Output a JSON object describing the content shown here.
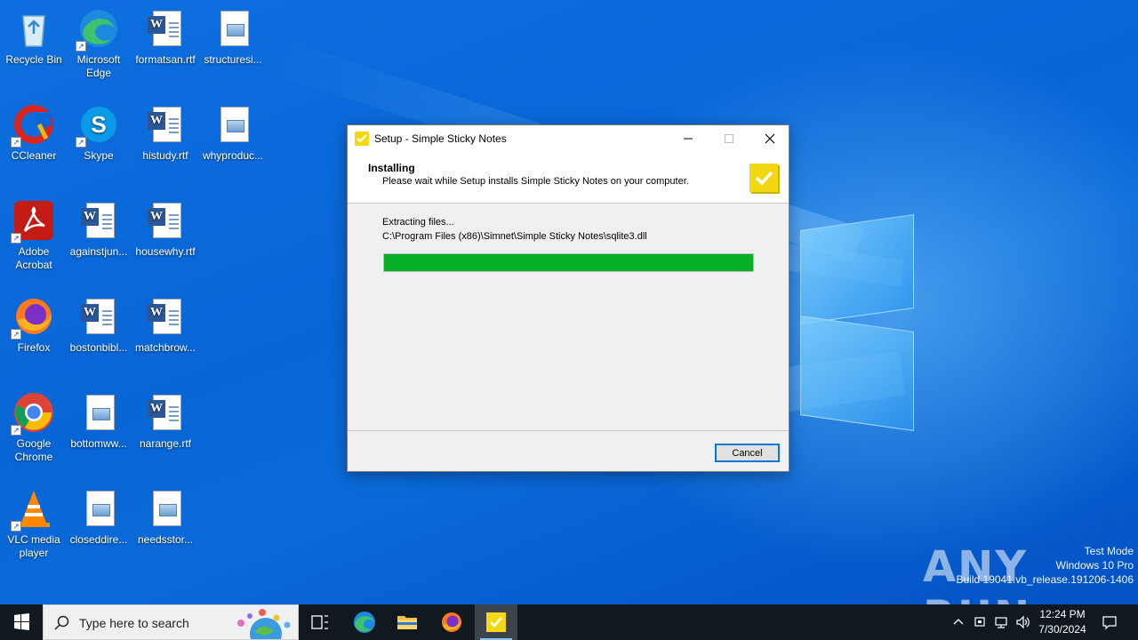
{
  "desktop": {
    "icons": [
      {
        "label": "Recycle Bin"
      },
      {
        "label": "Microsoft Edge"
      },
      {
        "label": "formatsan.rtf"
      },
      {
        "label": "structuresi..."
      },
      {
        "label": "CCleaner"
      },
      {
        "label": "Skype"
      },
      {
        "label": "histudy.rtf"
      },
      {
        "label": "whyproduc..."
      },
      {
        "label": "Adobe Acrobat"
      },
      {
        "label": "againstjun..."
      },
      {
        "label": "housewhy.rtf"
      },
      {
        "label": "Firefox"
      },
      {
        "label": "bostonbibl..."
      },
      {
        "label": "matchbrow..."
      },
      {
        "label": "Google Chrome"
      },
      {
        "label": "bottomww..."
      },
      {
        "label": "narange.rtf"
      },
      {
        "label": "VLC media player"
      },
      {
        "label": "closeddire..."
      },
      {
        "label": "needsstor..."
      }
    ]
  },
  "setup": {
    "title": "Setup - Simple Sticky Notes",
    "header_title": "Installing",
    "header_subtitle": "Please wait while Setup installs Simple Sticky Notes on your computer.",
    "status_line1": "Extracting files...",
    "status_line2": "C:\\Program Files (x86)\\Simnet\\Simple Sticky Notes\\sqlite3.dll",
    "progress": 1.0,
    "cancel_label": "Cancel"
  },
  "watermark": {
    "brand": "ANY RUN",
    "line1": "Test Mode",
    "line2": "Windows 10 Pro",
    "line3": "Build 19041.vb_release.191206-1406"
  },
  "taskbar": {
    "search_placeholder": "Type here to search",
    "clock_time": "12:24 PM",
    "clock_date": "7/30/2024"
  },
  "colors": {
    "progress_fill": "#06b025",
    "accent": "#0078d7",
    "sticky_yellow": "#f2d711"
  }
}
